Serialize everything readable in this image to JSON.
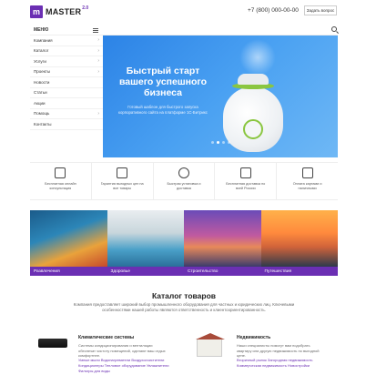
{
  "header": {
    "logo_letter": "m",
    "logo_name": "MASTER",
    "logo_version": "2.0",
    "phone": "+7 (800) 000-00-00",
    "ask_button": "Задать вопрос"
  },
  "menu": {
    "label": "МЕНЮ"
  },
  "sidebar": {
    "items": [
      {
        "label": "Компания",
        "arrow": "›"
      },
      {
        "label": "Каталог",
        "arrow": "›"
      },
      {
        "label": "Услуги",
        "arrow": "›"
      },
      {
        "label": "Проекты",
        "arrow": "›"
      },
      {
        "label": "Новости",
        "arrow": ""
      },
      {
        "label": "Статьи",
        "arrow": ""
      },
      {
        "label": "Акции",
        "arrow": ""
      },
      {
        "label": "Помощь",
        "arrow": "›"
      },
      {
        "label": "Контакты",
        "arrow": ""
      }
    ]
  },
  "hero": {
    "title": "Быстрый старт вашего успешного бизнеса",
    "subtitle": "Готовый шаблон для быстрого запуска корпоративного сайта на платформе 1С-Битрикс",
    "slide_count": 4,
    "active_slide": 2
  },
  "features": [
    {
      "label": "Бесплатная онлайн консультация",
      "icon": "chat-icon"
    },
    {
      "label": "Гарантия выгодных цен на все товары",
      "icon": "document-icon"
    },
    {
      "label": "Быстрая установка и доставка",
      "icon": "tools-icon"
    },
    {
      "label": "Бесплатная доставка по всей России",
      "icon": "box-icon"
    },
    {
      "label": "Оплата картами и наличными",
      "icon": "card-icon"
    }
  ],
  "categories": [
    {
      "label": "Развлечения"
    },
    {
      "label": "Здоровье"
    },
    {
      "label": "Строительство"
    },
    {
      "label": "Путешествия"
    }
  ],
  "catalog": {
    "title": "Каталог товаров",
    "description": "Компания предоставляет широкий выбор промышленного оборудования для частных и юридических лиц. Ключевыми особенностями нашей работы являются ответственность и клиентоориентированность."
  },
  "products": [
    {
      "title": "Климатические системы",
      "text": "Системы кондиционирования и вентиляции обеспечат чистоту помещений, сделают ваш отдых комфортнее.",
      "links": "Умные мыли Водонагреватели Воздухоочистители Кондиционеры Тепловое оборудование Увлажнители Фильтры для воды"
    },
    {
      "title": "Недвижимость",
      "text": "Наши специалисты помогут вам подобрать квартиру или другую недвижимость по выгодной цене.",
      "links": "Вторичный рынок Загородная недвижимость Коммерческая недвижимость Новостройки"
    }
  ],
  "colors": {
    "accent": "#6b2fb3",
    "hero_blue": "#3a93ec"
  }
}
